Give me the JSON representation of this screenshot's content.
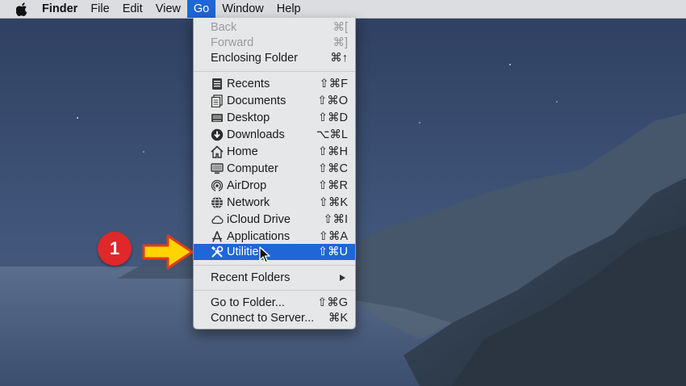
{
  "menubar": {
    "apple_icon": "apple-logo-icon",
    "items": [
      {
        "label": "Finder"
      },
      {
        "label": "File"
      },
      {
        "label": "Edit"
      },
      {
        "label": "View"
      },
      {
        "label": "Go"
      },
      {
        "label": "Window"
      },
      {
        "label": "Help"
      }
    ],
    "active_item": "Go",
    "active_color": "#1f66d6"
  },
  "go_menu": {
    "history": [
      {
        "label": "Back",
        "shortcut": "⌘[",
        "enabled": false
      },
      {
        "label": "Forward",
        "shortcut": "⌘]",
        "enabled": false
      },
      {
        "label": "Enclosing Folder",
        "shortcut": "⌘↑",
        "enabled": true
      }
    ],
    "places": [
      {
        "label": "Recents",
        "shortcut": "⇧⌘F",
        "icon": "recents-icon"
      },
      {
        "label": "Documents",
        "shortcut": "⇧⌘O",
        "icon": "documents-icon"
      },
      {
        "label": "Desktop",
        "shortcut": "⇧⌘D",
        "icon": "desktop-icon"
      },
      {
        "label": "Downloads",
        "shortcut": "⌥⌘L",
        "icon": "downloads-icon"
      },
      {
        "label": "Home",
        "shortcut": "⇧⌘H",
        "icon": "home-icon"
      },
      {
        "label": "Computer",
        "shortcut": "⇧⌘C",
        "icon": "computer-icon"
      },
      {
        "label": "AirDrop",
        "shortcut": "⇧⌘R",
        "icon": "airdrop-icon"
      },
      {
        "label": "Network",
        "shortcut": "⇧⌘K",
        "icon": "network-icon"
      },
      {
        "label": "iCloud Drive",
        "shortcut": "⇧⌘I",
        "icon": "icloud-icon"
      },
      {
        "label": "Applications",
        "shortcut": "⇧⌘A",
        "icon": "applications-icon"
      },
      {
        "label": "Utilities",
        "shortcut": "⇧⌘U",
        "icon": "utilities-icon",
        "selected": true
      }
    ],
    "recent_folders": {
      "label": "Recent Folders"
    },
    "server": [
      {
        "label": "Go to Folder...",
        "shortcut": "⇧⌘G"
      },
      {
        "label": "Connect to Server...",
        "shortcut": "⌘K"
      }
    ]
  },
  "annotation": {
    "step_number": "1",
    "step_color": "#e0272a",
    "arrow_color": "#ffd400"
  }
}
